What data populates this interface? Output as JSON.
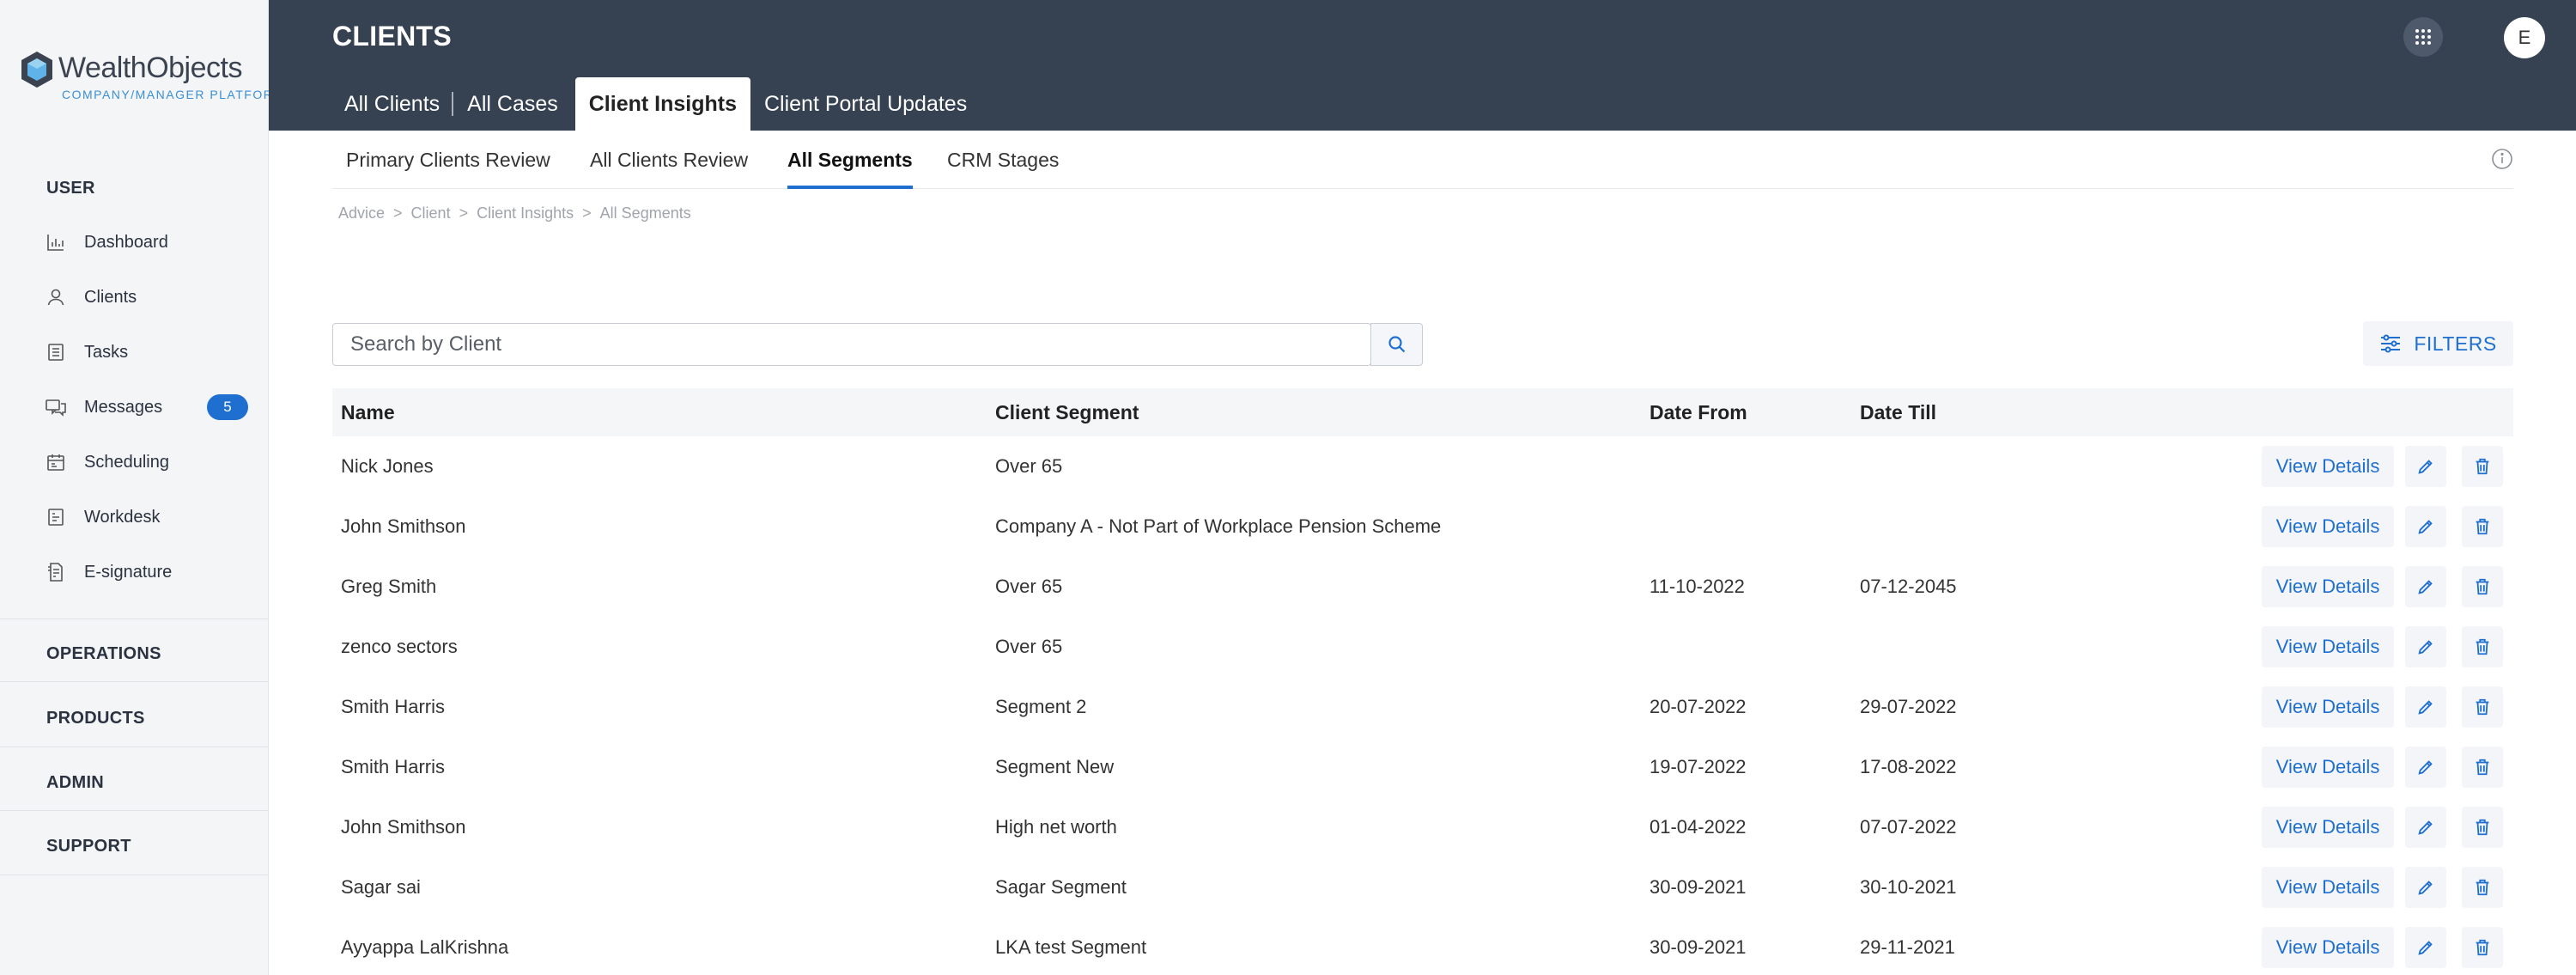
{
  "brand": {
    "name": "WealthObjects",
    "subtitle": "COMPANY/MANAGER PLATFORM",
    "accent": "#1f6fd1",
    "header_bg": "#364152"
  },
  "sidebar": {
    "user_section": "USER",
    "items": [
      {
        "label": "Dashboard",
        "icon": "bar-chart-icon"
      },
      {
        "label": "Clients",
        "icon": "user-icon"
      },
      {
        "label": "Tasks",
        "icon": "tasks-icon"
      },
      {
        "label": "Messages",
        "icon": "messages-icon",
        "badge": "5"
      },
      {
        "label": "Scheduling",
        "icon": "calendar-icon"
      },
      {
        "label": "Workdesk",
        "icon": "workdesk-icon"
      },
      {
        "label": "E-signature",
        "icon": "signature-icon"
      }
    ],
    "sections": [
      "OPERATIONS",
      "PRODUCTS",
      "ADMIN",
      "SUPPORT"
    ]
  },
  "header": {
    "title": "CLIENTS",
    "avatar_initial": "E",
    "tabs": [
      "All Clients",
      "All Cases",
      "Client Insights",
      "Client Portal Updates"
    ],
    "active_tab": "Client Insights"
  },
  "sub_tabs": {
    "items": [
      "Primary Clients Review",
      "All Clients Review",
      "All Segments",
      "CRM Stages"
    ],
    "active": "All Segments"
  },
  "breadcrumb": [
    "Advice",
    "Client",
    "Client Insights",
    "All Segments"
  ],
  "search": {
    "placeholder": "Search by Client",
    "value": ""
  },
  "filters_label": "FILTERS",
  "table": {
    "columns": [
      "Name",
      "Client Segment",
      "Date From",
      "Date Till"
    ],
    "view_label": "View Details",
    "rows": [
      {
        "name": "Nick Jones",
        "segment": "Over 65",
        "from": "",
        "till": ""
      },
      {
        "name": "John Smithson",
        "segment": "Company A - Not Part of Workplace Pension Scheme",
        "from": "",
        "till": ""
      },
      {
        "name": "Greg Smith",
        "segment": "Over 65",
        "from": "11-10-2022",
        "till": "07-12-2045"
      },
      {
        "name": "zenco sectors",
        "segment": "Over 65",
        "from": "",
        "till": ""
      },
      {
        "name": "Smith Harris",
        "segment": "Segment 2",
        "from": "20-07-2022",
        "till": "29-07-2022"
      },
      {
        "name": "Smith Harris",
        "segment": "Segment New",
        "from": "19-07-2022",
        "till": "17-08-2022"
      },
      {
        "name": "John Smithson",
        "segment": "High net worth",
        "from": "01-04-2022",
        "till": "07-07-2022"
      },
      {
        "name": "Sagar sai",
        "segment": "Sagar Segment",
        "from": "30-09-2021",
        "till": "30-10-2021"
      },
      {
        "name": "Ayyappa LalKrishna",
        "segment": "LKA test Segment",
        "from": "30-09-2021",
        "till": "29-11-2021"
      }
    ]
  }
}
